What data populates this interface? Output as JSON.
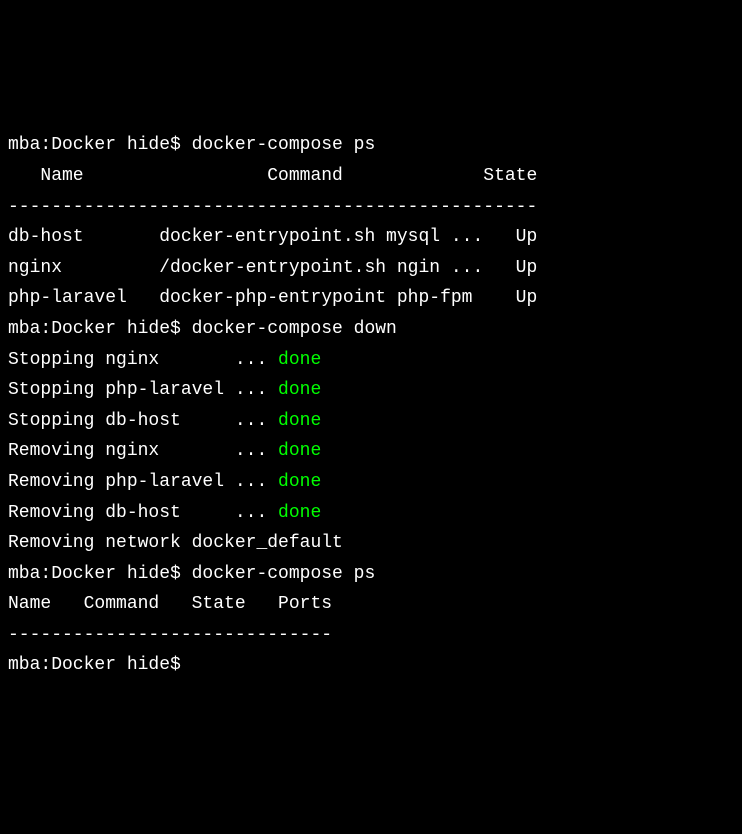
{
  "prompt1": "mba:Docker hide$ docker-compose ps",
  "header": "   Name                 Command             State",
  "divider1": "-------------------------------------------------",
  "ps_rows": [
    "db-host       docker-entrypoint.sh mysql ...   Up",
    "nginx         /docker-entrypoint.sh ngin ...   Up",
    "php-laravel   docker-php-entrypoint php-fpm    Up"
  ],
  "prompt2": "mba:Docker hide$ docker-compose down",
  "ops": [
    {
      "label": "Stopping nginx       ... ",
      "status": "done"
    },
    {
      "label": "Stopping php-laravel ... ",
      "status": "done"
    },
    {
      "label": "Stopping db-host     ... ",
      "status": "done"
    },
    {
      "label": "Removing nginx       ... ",
      "status": "done"
    },
    {
      "label": "Removing php-laravel ... ",
      "status": "done"
    },
    {
      "label": "Removing db-host     ... ",
      "status": "done"
    }
  ],
  "network_line": "Removing network docker_default",
  "prompt3": "mba:Docker hide$ docker-compose ps",
  "header2": "Name   Command   State   Ports",
  "divider2": "------------------------------",
  "prompt4": "mba:Docker hide$ "
}
